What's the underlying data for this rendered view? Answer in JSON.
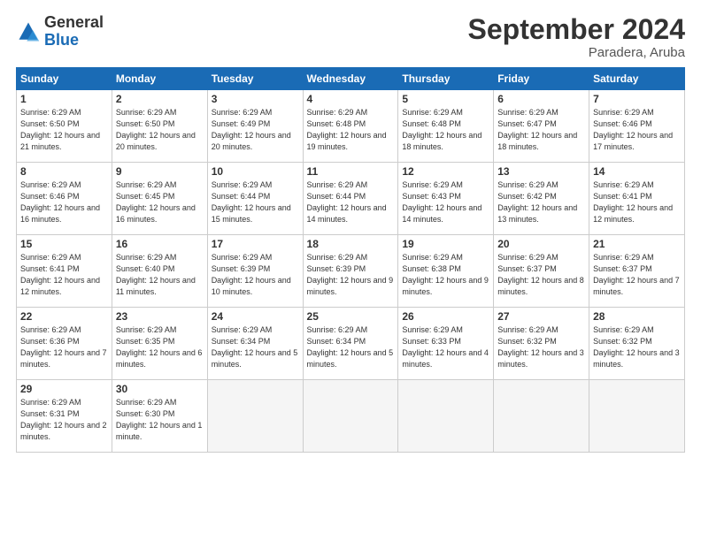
{
  "logo": {
    "general": "General",
    "blue": "Blue"
  },
  "title": "September 2024",
  "subtitle": "Paradera, Aruba",
  "days_header": [
    "Sunday",
    "Monday",
    "Tuesday",
    "Wednesday",
    "Thursday",
    "Friday",
    "Saturday"
  ],
  "weeks": [
    [
      {
        "day": "1",
        "rise": "6:29 AM",
        "set": "6:50 PM",
        "daylight": "12 hours and 21 minutes."
      },
      {
        "day": "2",
        "rise": "6:29 AM",
        "set": "6:50 PM",
        "daylight": "12 hours and 20 minutes."
      },
      {
        "day": "3",
        "rise": "6:29 AM",
        "set": "6:49 PM",
        "daylight": "12 hours and 20 minutes."
      },
      {
        "day": "4",
        "rise": "6:29 AM",
        "set": "6:48 PM",
        "daylight": "12 hours and 19 minutes."
      },
      {
        "day": "5",
        "rise": "6:29 AM",
        "set": "6:48 PM",
        "daylight": "12 hours and 18 minutes."
      },
      {
        "day": "6",
        "rise": "6:29 AM",
        "set": "6:47 PM",
        "daylight": "12 hours and 18 minutes."
      },
      {
        "day": "7",
        "rise": "6:29 AM",
        "set": "6:46 PM",
        "daylight": "12 hours and 17 minutes."
      }
    ],
    [
      {
        "day": "8",
        "rise": "6:29 AM",
        "set": "6:46 PM",
        "daylight": "12 hours and 16 minutes."
      },
      {
        "day": "9",
        "rise": "6:29 AM",
        "set": "6:45 PM",
        "daylight": "12 hours and 16 minutes."
      },
      {
        "day": "10",
        "rise": "6:29 AM",
        "set": "6:44 PM",
        "daylight": "12 hours and 15 minutes."
      },
      {
        "day": "11",
        "rise": "6:29 AM",
        "set": "6:44 PM",
        "daylight": "12 hours and 14 minutes."
      },
      {
        "day": "12",
        "rise": "6:29 AM",
        "set": "6:43 PM",
        "daylight": "12 hours and 14 minutes."
      },
      {
        "day": "13",
        "rise": "6:29 AM",
        "set": "6:42 PM",
        "daylight": "12 hours and 13 minutes."
      },
      {
        "day": "14",
        "rise": "6:29 AM",
        "set": "6:41 PM",
        "daylight": "12 hours and 12 minutes."
      }
    ],
    [
      {
        "day": "15",
        "rise": "6:29 AM",
        "set": "6:41 PM",
        "daylight": "12 hours and 12 minutes."
      },
      {
        "day": "16",
        "rise": "6:29 AM",
        "set": "6:40 PM",
        "daylight": "12 hours and 11 minutes."
      },
      {
        "day": "17",
        "rise": "6:29 AM",
        "set": "6:39 PM",
        "daylight": "12 hours and 10 minutes."
      },
      {
        "day": "18",
        "rise": "6:29 AM",
        "set": "6:39 PM",
        "daylight": "12 hours and 9 minutes."
      },
      {
        "day": "19",
        "rise": "6:29 AM",
        "set": "6:38 PM",
        "daylight": "12 hours and 9 minutes."
      },
      {
        "day": "20",
        "rise": "6:29 AM",
        "set": "6:37 PM",
        "daylight": "12 hours and 8 minutes."
      },
      {
        "day": "21",
        "rise": "6:29 AM",
        "set": "6:37 PM",
        "daylight": "12 hours and 7 minutes."
      }
    ],
    [
      {
        "day": "22",
        "rise": "6:29 AM",
        "set": "6:36 PM",
        "daylight": "12 hours and 7 minutes."
      },
      {
        "day": "23",
        "rise": "6:29 AM",
        "set": "6:35 PM",
        "daylight": "12 hours and 6 minutes."
      },
      {
        "day": "24",
        "rise": "6:29 AM",
        "set": "6:34 PM",
        "daylight": "12 hours and 5 minutes."
      },
      {
        "day": "25",
        "rise": "6:29 AM",
        "set": "6:34 PM",
        "daylight": "12 hours and 5 minutes."
      },
      {
        "day": "26",
        "rise": "6:29 AM",
        "set": "6:33 PM",
        "daylight": "12 hours and 4 minutes."
      },
      {
        "day": "27",
        "rise": "6:29 AM",
        "set": "6:32 PM",
        "daylight": "12 hours and 3 minutes."
      },
      {
        "day": "28",
        "rise": "6:29 AM",
        "set": "6:32 PM",
        "daylight": "12 hours and 3 minutes."
      }
    ],
    [
      {
        "day": "29",
        "rise": "6:29 AM",
        "set": "6:31 PM",
        "daylight": "12 hours and 2 minutes."
      },
      {
        "day": "30",
        "rise": "6:29 AM",
        "set": "6:30 PM",
        "daylight": "12 hours and 1 minute."
      },
      null,
      null,
      null,
      null,
      null
    ]
  ]
}
